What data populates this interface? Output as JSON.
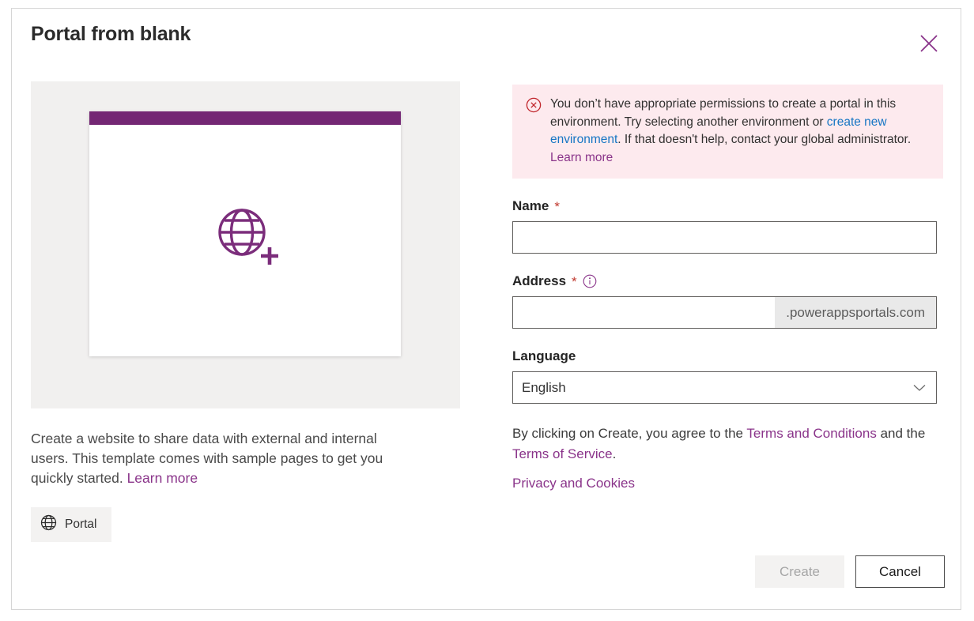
{
  "dialog": {
    "title": "Portal from blank",
    "close_label": "Close"
  },
  "preview": {
    "icon": "globe-plus-icon",
    "accent_color": "#742774"
  },
  "left": {
    "description_part1": "Create a website to share data with external and internal users. This template comes with sample pages to get you quickly started. ",
    "description_link": "Learn more",
    "tag_icon": "globe-icon",
    "tag_label": "Portal"
  },
  "error": {
    "icon": "error-circle-x-icon",
    "icon_color": "#c1272d",
    "background_color": "#fdeaee",
    "text_part1": "You don’t have appropriate permissions to create a portal in this environment. Try selecting another environment or ",
    "link1": "create new environment",
    "link1_color": "#1676c4",
    "text_part2": ". If that doesn't help, contact your global administrator. ",
    "link2": "Learn more",
    "link2_color": "#8a348a"
  },
  "form": {
    "name": {
      "label": "Name",
      "required_marker": "*",
      "value": "",
      "placeholder": ""
    },
    "address": {
      "label": "Address",
      "required_marker": "*",
      "info_icon": "info-circle-icon",
      "value": "",
      "placeholder": "",
      "suffix": ".powerappsportals.com"
    },
    "language": {
      "label": "Language",
      "selected": "English",
      "chevron_icon": "chevron-down-icon"
    }
  },
  "legal": {
    "text_part1": "By clicking on Create, you agree to the ",
    "link_terms_conditions": "Terms and Conditions",
    "text_part2": " and the ",
    "link_terms_service": "Terms of Service",
    "text_part3": ".",
    "link_privacy": "Privacy and Cookies"
  },
  "footer": {
    "create_label": "Create",
    "cancel_label": "Cancel"
  }
}
